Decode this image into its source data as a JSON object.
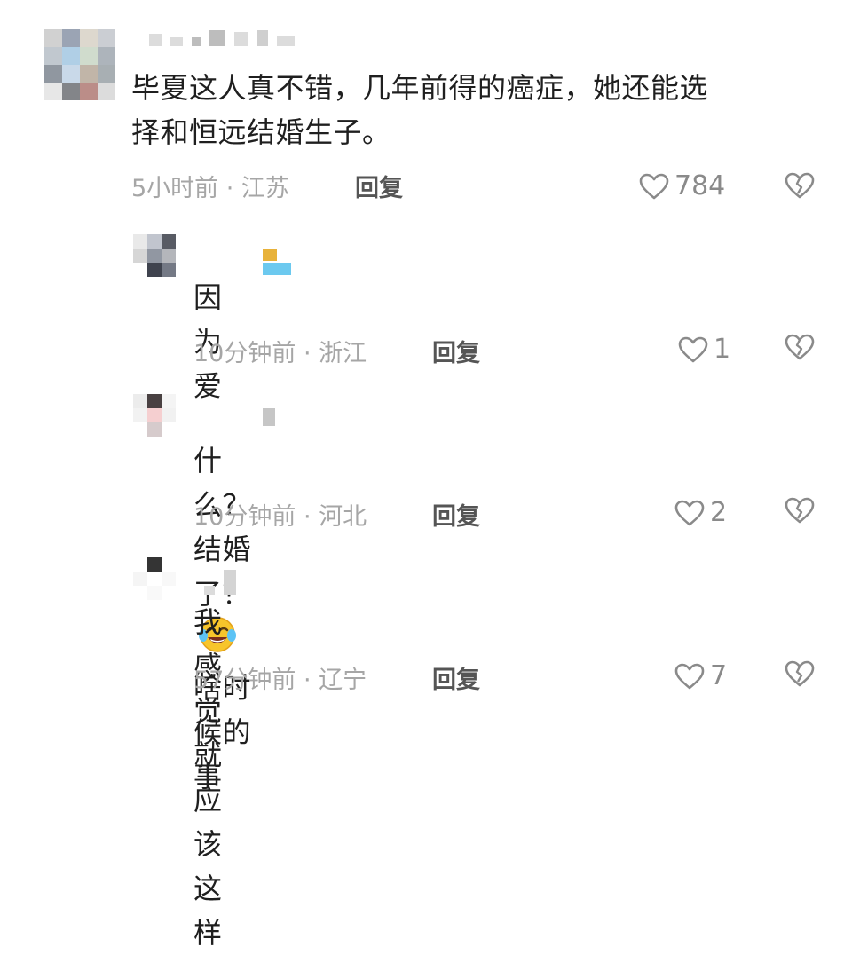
{
  "comments": [
    {
      "text_line1": "毕夏这人真不错，几年前得的癌症，她还能选",
      "text_line2": "择和恒远结婚生子。",
      "meta": "5小时前 · 江苏",
      "reply_label": "回复",
      "likes": "784"
    },
    {
      "text": "因为爱",
      "meta": "10分钟前 · 浙江",
      "reply_label": "回复",
      "likes": "1"
    },
    {
      "text_before_emoji": "什么？结婚了？",
      "emoji_name": "crying-laughing-emoji",
      "text_after_emoji": "啥时候的事",
      "meta": "10分钟前 · 河北",
      "reply_label": "回复",
      "likes": "2"
    },
    {
      "text": "我感觉就应该这样",
      "meta": "57分钟前 · 辽宁",
      "reply_label": "回复",
      "likes": "7"
    }
  ],
  "icons": {
    "like": "heart-outline-icon",
    "dislike": "broken-heart-icon"
  },
  "colors": {
    "text": "#1f1f1f",
    "meta": "#a6a6a6",
    "reply": "#555555",
    "icon": "#8a8a8a"
  }
}
